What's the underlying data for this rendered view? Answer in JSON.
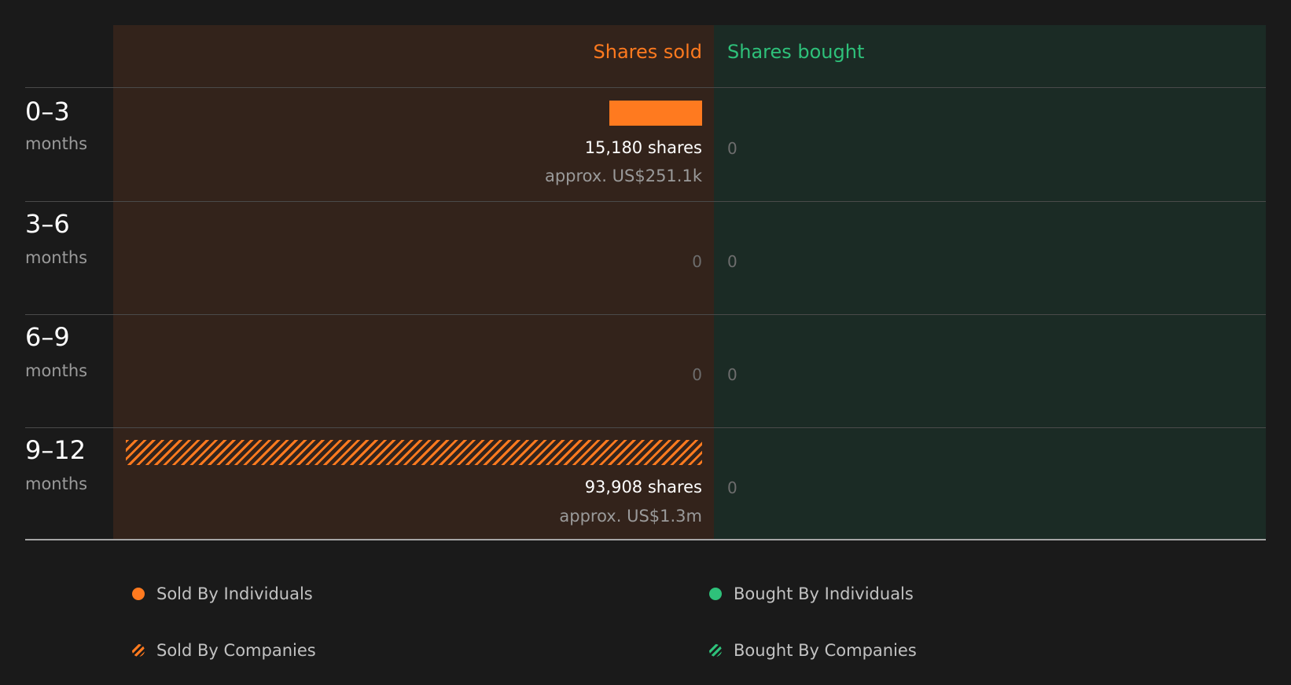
{
  "header": {
    "sold_label": "Shares sold",
    "bought_label": "Shares bought"
  },
  "colors": {
    "sold": "#ff7a1f",
    "bought": "#2ec17a"
  },
  "chart_data": {
    "type": "bar",
    "categories": [
      "0–3",
      "3–6",
      "6–9",
      "9–12"
    ],
    "unit_label": "months",
    "series": [
      {
        "name": "Sold By Individuals",
        "values": [
          15180,
          0,
          0,
          0
        ]
      },
      {
        "name": "Sold By Companies",
        "values": [
          0,
          0,
          0,
          93908
        ]
      },
      {
        "name": "Bought By Individuals",
        "values": [
          0,
          0,
          0,
          0
        ]
      },
      {
        "name": "Bought By Companies",
        "values": [
          0,
          0,
          0,
          0
        ]
      }
    ],
    "rows": [
      {
        "period": "0–3",
        "unit": "months",
        "sold_shares": "15,180 shares",
        "sold_value": "approx. US$251.1k",
        "bought": "0"
      },
      {
        "period": "3–6",
        "unit": "months",
        "sold_zero": "0",
        "bought": "0"
      },
      {
        "period": "6–9",
        "unit": "months",
        "sold_zero": "0",
        "bought": "0"
      },
      {
        "period": "9–12",
        "unit": "months",
        "sold_shares": "93,908 shares",
        "sold_value": "approx. US$1.3m",
        "bought": "0"
      }
    ],
    "xlim": [
      0,
      93908
    ]
  },
  "legend": {
    "sold_individuals": "Sold By Individuals",
    "sold_companies": "Sold By Companies",
    "bought_individuals": "Bought By Individuals",
    "bought_companies": "Bought By Companies"
  }
}
